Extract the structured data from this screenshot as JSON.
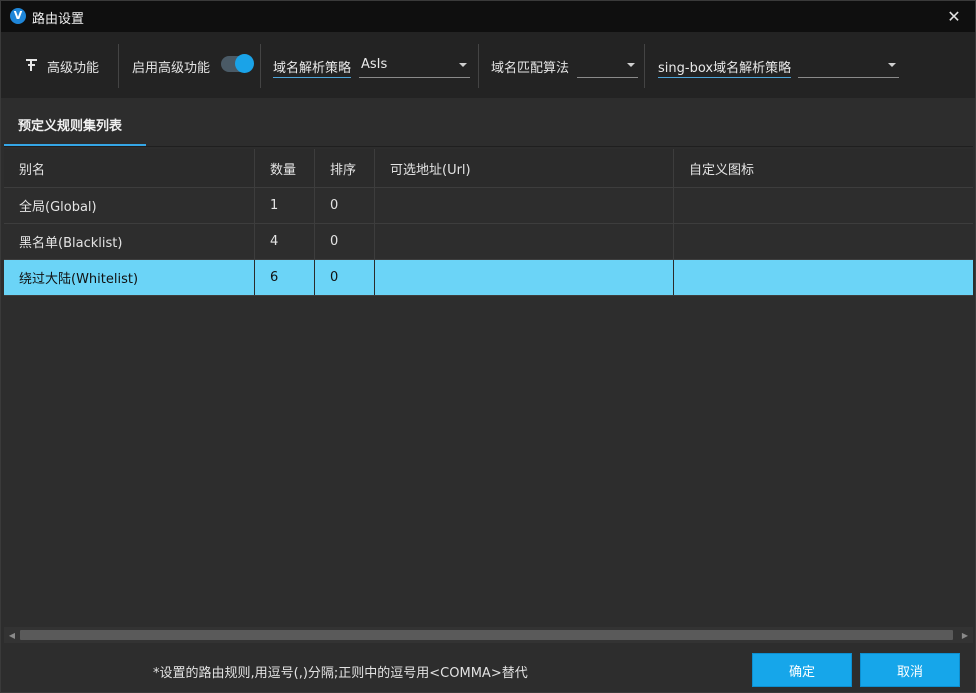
{
  "window": {
    "title": "路由设置",
    "app_icon_letter": "V",
    "close_glyph": "✕"
  },
  "toolbar": {
    "advanced_label": "高级功能",
    "enable_advanced_label": "启用高级功能",
    "enable_advanced_on": true,
    "domain_strategy_label": "域名解析策略",
    "domain_strategy_value": "AsIs",
    "domain_matcher_label": "域名匹配算法",
    "domain_matcher_value": "",
    "singbox_strategy_label": "sing-box域名解析策略",
    "singbox_strategy_value": ""
  },
  "tabs": [
    {
      "label": "预定义规则集列表",
      "active": true
    }
  ],
  "table": {
    "columns": [
      "别名",
      "数量",
      "排序",
      "可选地址(Url)",
      "自定义图标"
    ],
    "rows": [
      {
        "alias": "全局(Global)",
        "count": "1",
        "sort": "0",
        "url": "",
        "icon": "",
        "selected": false
      },
      {
        "alias": "黑名单(Blacklist)",
        "count": "4",
        "sort": "0",
        "url": "",
        "icon": "",
        "selected": false
      },
      {
        "alias": "绕过大陆(Whitelist)",
        "count": "6",
        "sort": "0",
        "url": "",
        "icon": "",
        "selected": true
      }
    ]
  },
  "footer": {
    "note": "*设置的路由规则,用逗号(,)分隔;正则中的逗号用<COMMA>替代",
    "ok_label": "确定",
    "cancel_label": "取消"
  },
  "colors": {
    "accent": "#16a6ea",
    "selected_row": "#6bd4f7",
    "background": "#2d2d2d",
    "titlebar": "#0f0f0f"
  }
}
